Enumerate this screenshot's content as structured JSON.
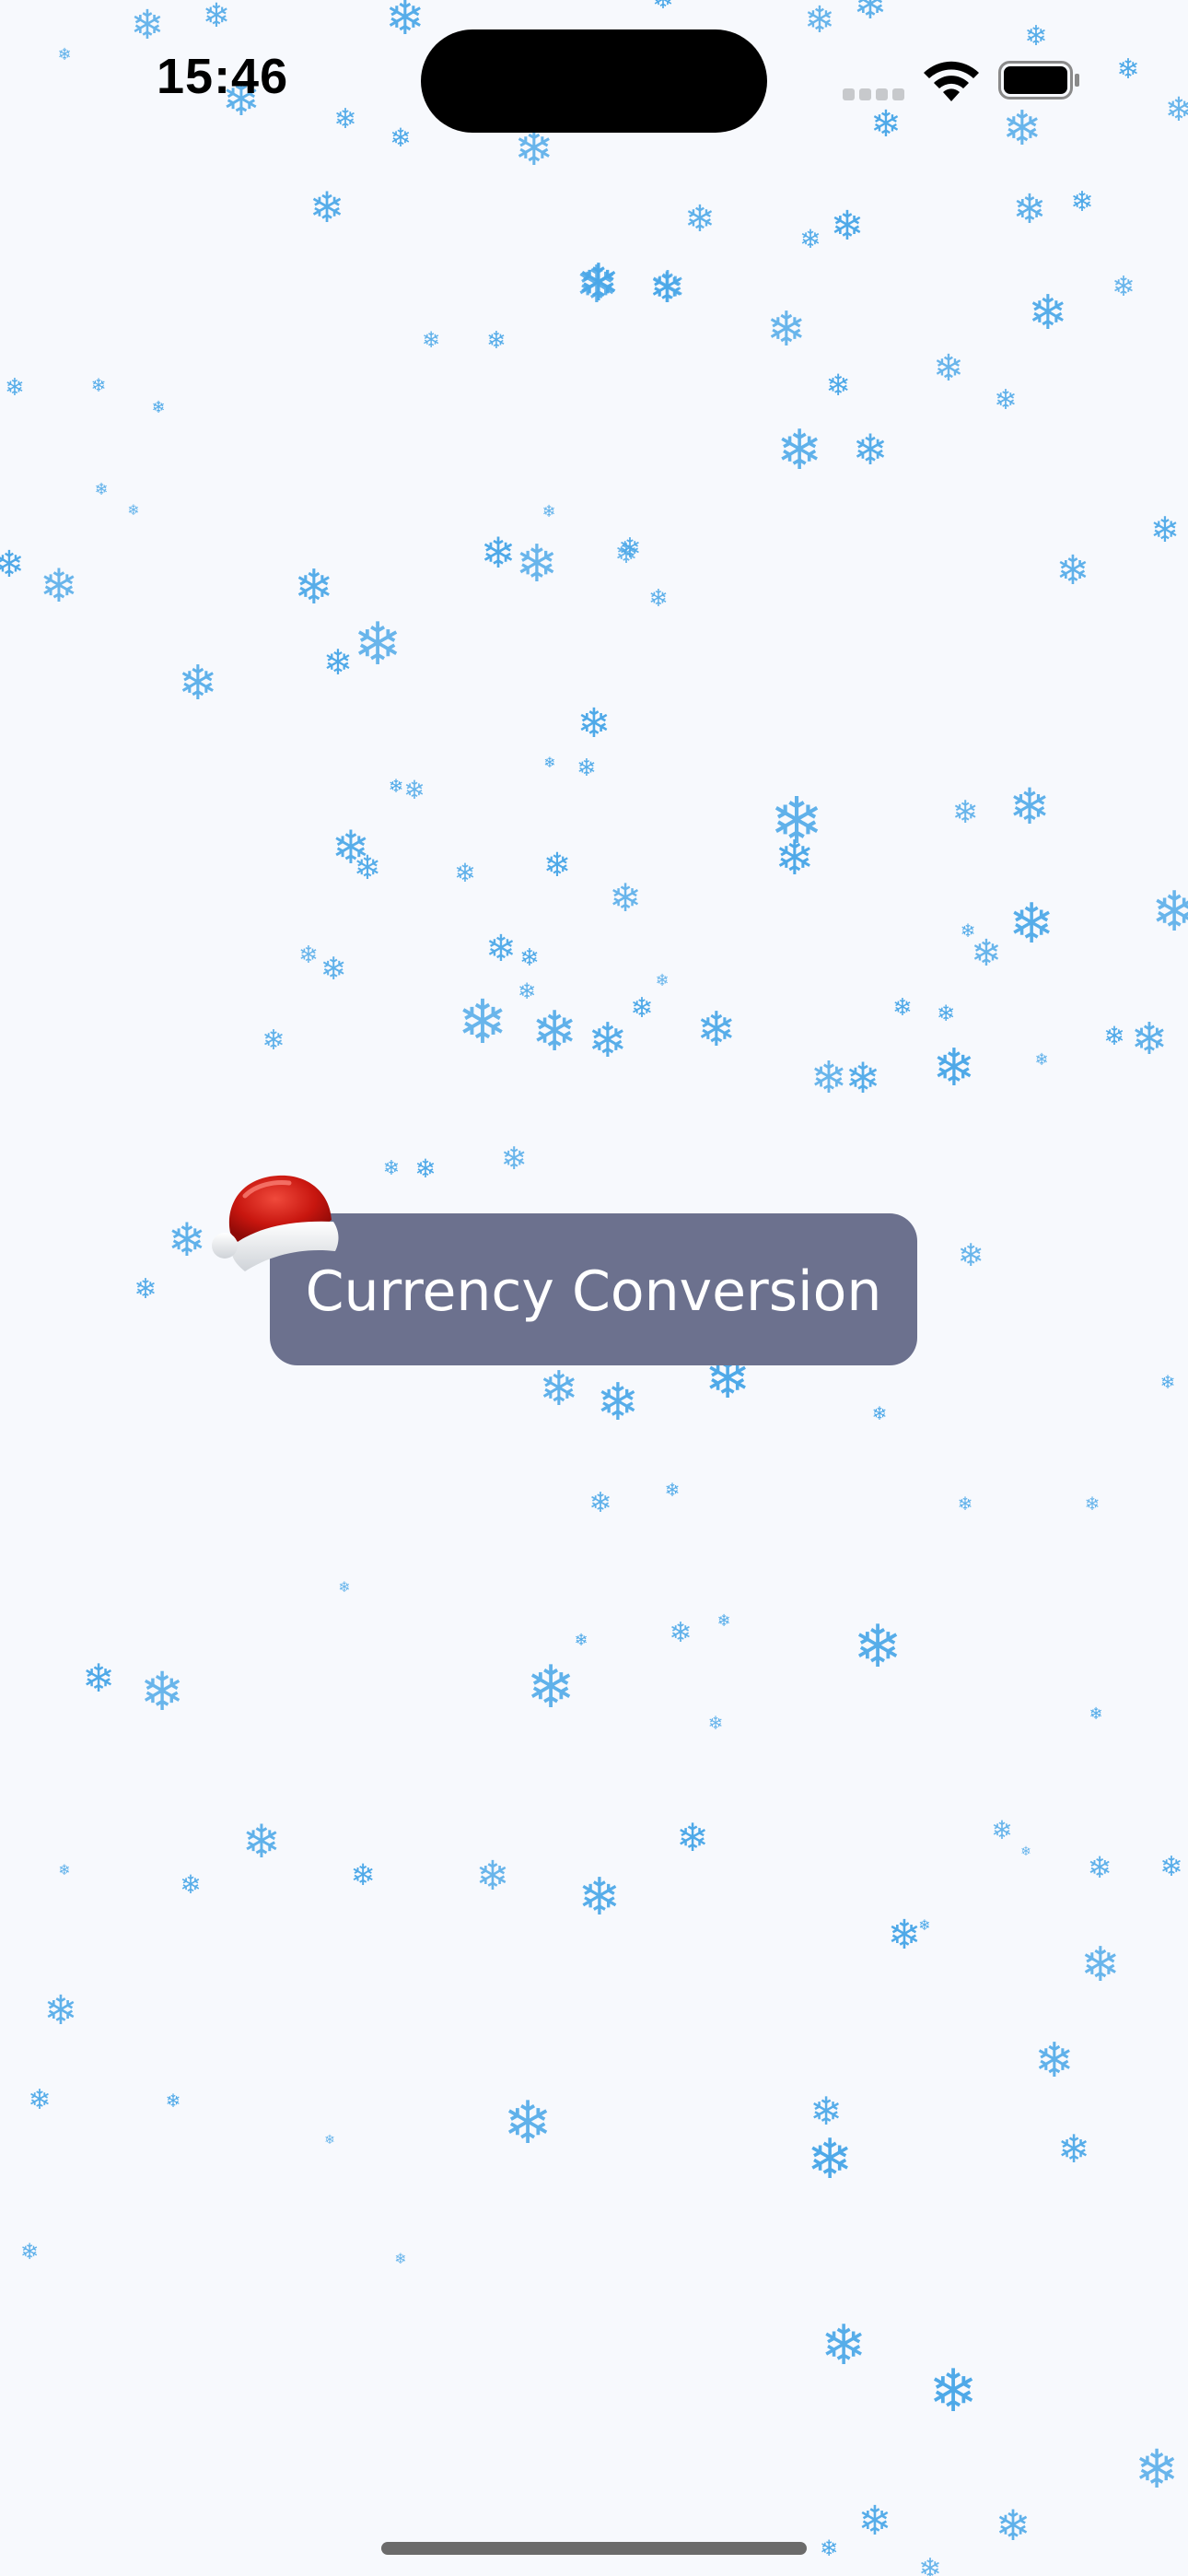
{
  "status_bar": {
    "time": "15:46"
  },
  "main": {
    "button_label": "Currency Conversion"
  },
  "icons": {
    "snowflake": "snowflake-icon",
    "hat": "santa-hat-icon",
    "wifi": "wifi-icon",
    "battery": "battery-icon",
    "signal": "cellular-signal-icon"
  },
  "colors": {
    "background": "#f7f9fd",
    "snowflake": "#4aa7e8",
    "button": "#6c718e",
    "button_text": "#ffffff"
  }
}
